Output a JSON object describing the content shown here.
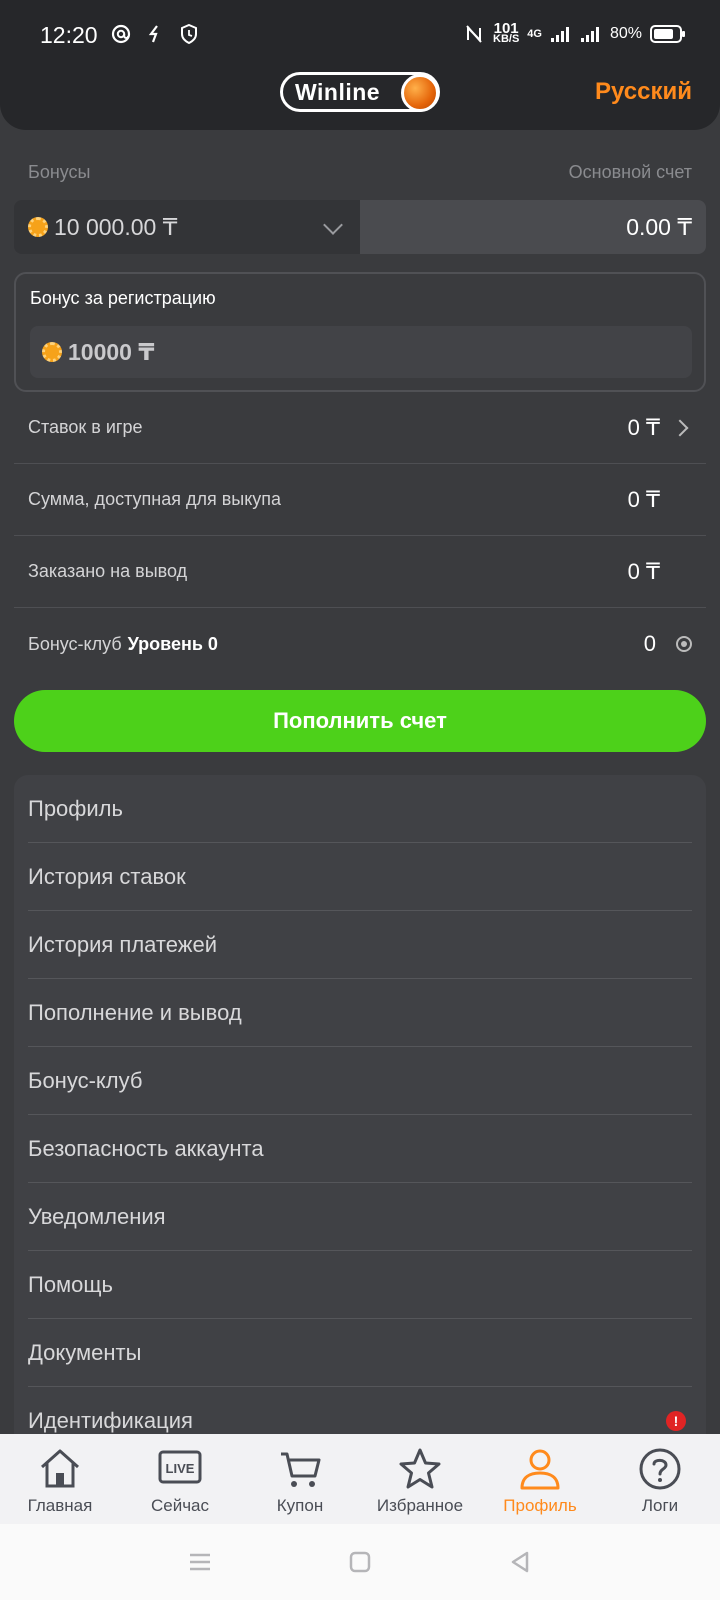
{
  "status_bar": {
    "time": "12:20",
    "net_speed_value": "101",
    "net_speed_unit": "KB/S",
    "network": "4G",
    "battery": "80%",
    "battery_level": 0.8
  },
  "header": {
    "logo_text": "Winline",
    "language": "Русский"
  },
  "balance": {
    "bonus_label": "Бонусы",
    "main_label": "Основной счет",
    "bonus_value": "10 000.00 ₸",
    "main_value": "0.00 ₸"
  },
  "registration_bonus": {
    "title": "Бонус за регистрацию",
    "value": "10000 ₸"
  },
  "info_rows": [
    {
      "label": "Ставок в игре",
      "value": "0 ₸"
    },
    {
      "label": "Сумма, доступная для выкупа",
      "value": "0 ₸"
    },
    {
      "label": "Заказано на вывод",
      "value": "0 ₸"
    },
    {
      "label": "Бонус-клуб",
      "level": "Уровень 0",
      "value": "0"
    }
  ],
  "topup_button": "Пополнить счет",
  "menu": [
    {
      "label": "Профиль"
    },
    {
      "label": "История ставок"
    },
    {
      "label": "История платежей"
    },
    {
      "label": "Пополнение и вывод"
    },
    {
      "label": "Бонус-клуб"
    },
    {
      "label": "Безопасность аккаунта"
    },
    {
      "label": "Уведомления"
    },
    {
      "label": "Помощь"
    },
    {
      "label": "Документы"
    },
    {
      "label": "Идентификация",
      "alert": "!"
    }
  ],
  "tabs": [
    {
      "label": "Главная",
      "icon": "home-icon"
    },
    {
      "label": "Сейчас",
      "icon": "live-icon",
      "icon_text": "LIVE"
    },
    {
      "label": "Купон",
      "icon": "cart-icon"
    },
    {
      "label": "Избранное",
      "icon": "star-icon"
    },
    {
      "label": "Профиль",
      "icon": "person-icon",
      "active": true
    },
    {
      "label": "Логи",
      "icon": "help-icon"
    }
  ],
  "colors": {
    "accent_orange": "#ff8a1c",
    "topup_green": "#4dd11a",
    "alert_red": "#e02424"
  }
}
